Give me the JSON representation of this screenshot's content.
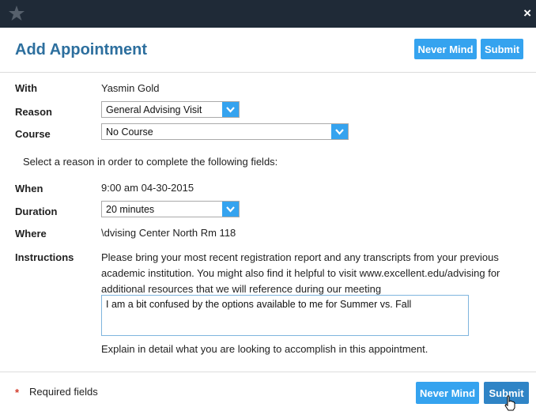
{
  "modal": {
    "title": "Add Appointment",
    "close_label": "×",
    "never_mind_label": "Never Mind",
    "submit_label": "Submit"
  },
  "form": {
    "with_label": "With",
    "with_value": "Yasmin Gold",
    "reason_label": "Reason",
    "reason_value": "General Advising Visit",
    "course_label": "Course",
    "course_value": "No Course",
    "select_reason_note": "Select a reason in order to complete the following fields:",
    "when_label": "When",
    "when_value": "9:00 am 04-30-2015",
    "duration_label": "Duration",
    "duration_value": "20 minutes",
    "where_label": "Where",
    "where_value": "\\dvising Center North Rm 118",
    "instructions_label": "Instructions",
    "instructions_text": "Please bring your most recent registration report and any transcripts from your previous academic institution. You might also find it helpful to visit www.excellent.edu/advising for additional resources that we will reference during our meeting",
    "comment_value": "I am a bit confused by the options available to me for Summer vs. Fall",
    "comment_hint": "Explain in detail what you are looking to accomplish in this appointment."
  },
  "footer": {
    "required_star": "*",
    "required_text": "Required fields",
    "never_mind_label": "Never Mind",
    "submit_label": "Submit"
  },
  "colors": {
    "topbar": "#1f2a37",
    "title": "#2d6f9e",
    "button_light": "#35a3ef",
    "button_dark": "#2f84c6",
    "required": "#d23b2b"
  },
  "icons": {
    "logo": "star-logo-icon",
    "close": "close-icon",
    "dropdown": "chevron-down-icon",
    "cursor": "hand-pointer-icon"
  }
}
